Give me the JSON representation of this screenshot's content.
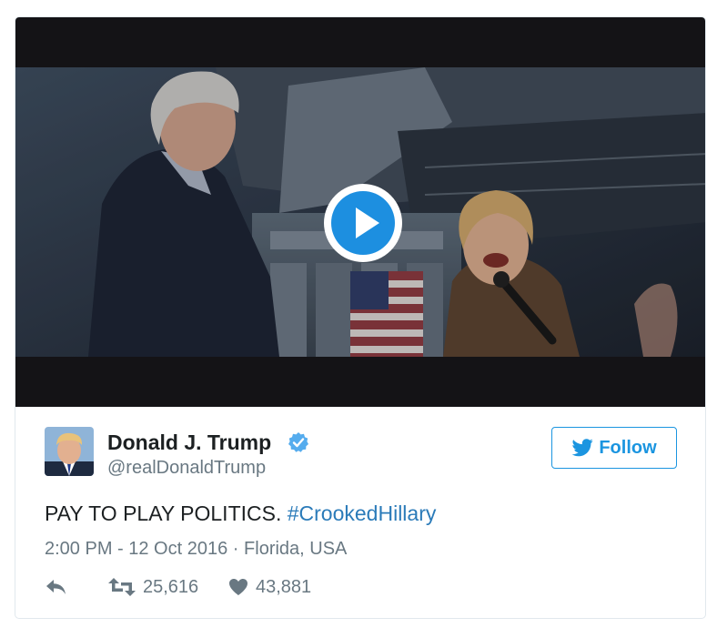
{
  "video": {
    "play_icon": "play-icon"
  },
  "author": {
    "name": "Donald J. Trump",
    "handle": "@realDonaldTrump",
    "verified_icon": "verified-badge-icon"
  },
  "follow_button": {
    "label": "Follow",
    "icon": "twitter-bird-icon"
  },
  "tweet": {
    "text": "PAY TO PLAY POLITICS.",
    "hashtag": "#CrookedHillary",
    "timestamp": "2:00 PM - 12 Oct 2016",
    "separator": "·",
    "location": "Florida, USA"
  },
  "actions": {
    "reply_icon": "reply-icon",
    "retweet_icon": "retweet-icon",
    "retweet_count": "25,616",
    "like_icon": "heart-icon",
    "like_count": "43,881"
  },
  "colors": {
    "brand_blue": "#1b95e0",
    "hashtag_blue": "#2b7bb9",
    "verified_blue": "#55acee",
    "text_dark": "#1c2022",
    "text_muted": "#697882",
    "border": "#e1e8ed"
  }
}
